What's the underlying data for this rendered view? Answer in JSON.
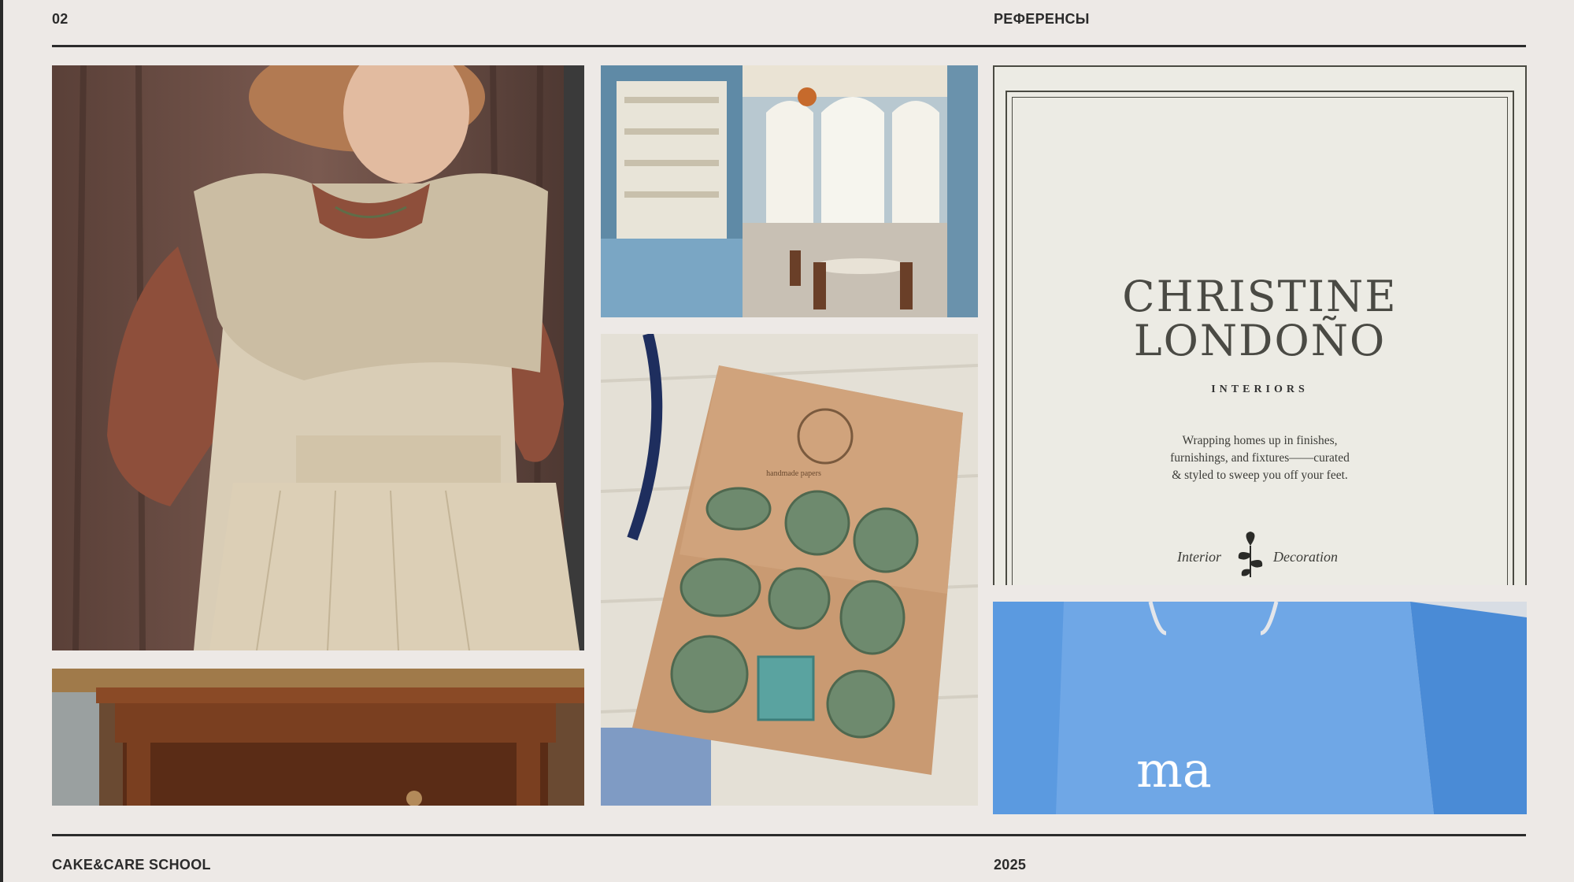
{
  "header": {
    "page_number": "02",
    "section_title": "РЕФЕРЕНСЫ"
  },
  "footer": {
    "school_name": "CAKE&CARE SCHOOL",
    "year": "2025"
  },
  "card": {
    "brand_line_1": "CHRISTINE",
    "brand_line_2": "LONDOÑO",
    "subtitle": "INTERIORS",
    "tagline_lines": [
      "Wrapping homes up in finishes,",
      "furnishings, and fixtures——curated",
      "& styled to sweep you off your feet."
    ],
    "footer_left": "Interior",
    "footer_right": "Decoration"
  },
  "bag": {
    "logo_text": "ma"
  },
  "envelope": {
    "label": "handmade papers"
  },
  "colors": {
    "background": "#ede9e6",
    "rule": "#2b2b2b",
    "card": "#ecebe4",
    "bag_blue": "#6fa7e6",
    "kraft": "#c99a72",
    "wax_green": "#6e8a6e"
  }
}
